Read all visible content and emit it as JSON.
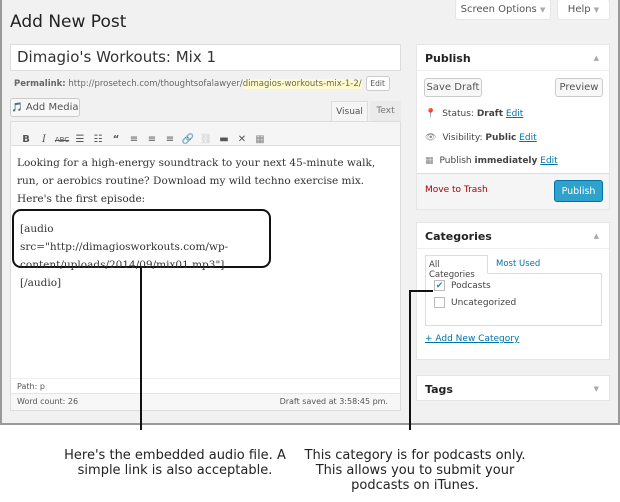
{
  "header": {
    "title": "Add New Post",
    "screen_options": "Screen Options",
    "help": "Help"
  },
  "post": {
    "title": "Dimagio's Workouts: Mix 1",
    "permalink_label": "Permalink:",
    "permalink_base": "http://prosetech.com/thoughtsofalawyer/",
    "permalink_slug": "dimagios-workouts-mix-1-2/",
    "permalink_edit": "Edit"
  },
  "editor": {
    "add_media": "Add Media",
    "tab_visual": "Visual",
    "tab_text": "Text",
    "toolbar": [
      "bold-icon",
      "italic-icon",
      "strikethrough-icon",
      "bullet-list-icon",
      "numbered-list-icon",
      "blockquote-icon",
      "align-left-icon",
      "align-center-icon",
      "align-right-icon",
      "link-icon",
      "unlink-icon",
      "read-more-icon",
      "fullscreen-icon",
      "toolbar-toggle-icon"
    ],
    "paragraph": "Looking for a high-energy soundtrack to your next 45-minute walk, run, or aerobics routine? Download my wild techno exercise mix. Here's the first episode:",
    "shortcode": "[audio src=\"http://dimagiosworkouts.com/wp-content/uploads/2014/09/mix01.mp3\"][/audio]",
    "path": "Path: p",
    "word_count": "Word count: 26",
    "draft_saved": "Draft saved at 3:58:45 pm."
  },
  "publish": {
    "title": "Publish",
    "save_draft": "Save Draft",
    "preview": "Preview",
    "status_label": "Status:",
    "status_value": "Draft",
    "visibility_label": "Visibility:",
    "visibility_value": "Public",
    "publish_label": "Publish",
    "publish_value": "immediately",
    "edit": "Edit",
    "trash": "Move to Trash",
    "publish_button": "Publish",
    "accent": "#2ea2cc",
    "trash_color": "#a00"
  },
  "categories": {
    "title": "Categories",
    "tab_all": "All Categories",
    "tab_most_used": "Most Used",
    "items": [
      {
        "label": "Podcasts",
        "checked": true
      },
      {
        "label": "Uncategorized",
        "checked": false
      }
    ],
    "add_new": "+ Add New Category"
  },
  "tags": {
    "title": "Tags"
  },
  "annotations": {
    "left": "Here's the embedded audio file. A simple link is also acceptable.",
    "right": "This category is for podcasts only. This allows you to submit your podcasts on iTunes."
  }
}
